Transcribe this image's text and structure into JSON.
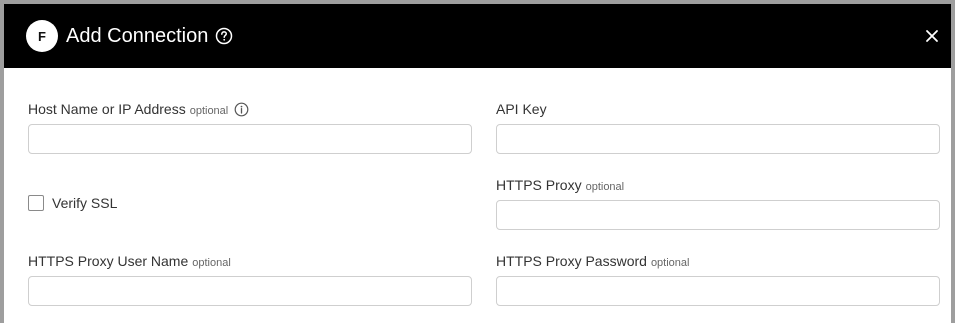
{
  "dialog": {
    "title": "Add Connection",
    "logo_text": "F",
    "help_icon": "question-circle-icon",
    "close_icon": "close-icon"
  },
  "form": {
    "host": {
      "label": "Host Name or IP Address",
      "optional": "optional",
      "value": "",
      "placeholder": ""
    },
    "api_key": {
      "label": "API Key",
      "value": "",
      "placeholder": ""
    },
    "verify_ssl": {
      "label": "Verify SSL",
      "checked": false
    },
    "https_proxy": {
      "label": "HTTPS Proxy",
      "optional": "optional",
      "value": "",
      "placeholder": ""
    },
    "proxy_user": {
      "label": "HTTPS Proxy User Name",
      "optional": "optional",
      "value": "",
      "placeholder": ""
    },
    "proxy_password": {
      "label": "HTTPS Proxy Password",
      "optional": "optional",
      "value": "",
      "placeholder": ""
    }
  },
  "colors": {
    "header_bg": "#000000",
    "border": "#cfcfcf",
    "label_text": "#333333",
    "optional_text": "#666666"
  }
}
